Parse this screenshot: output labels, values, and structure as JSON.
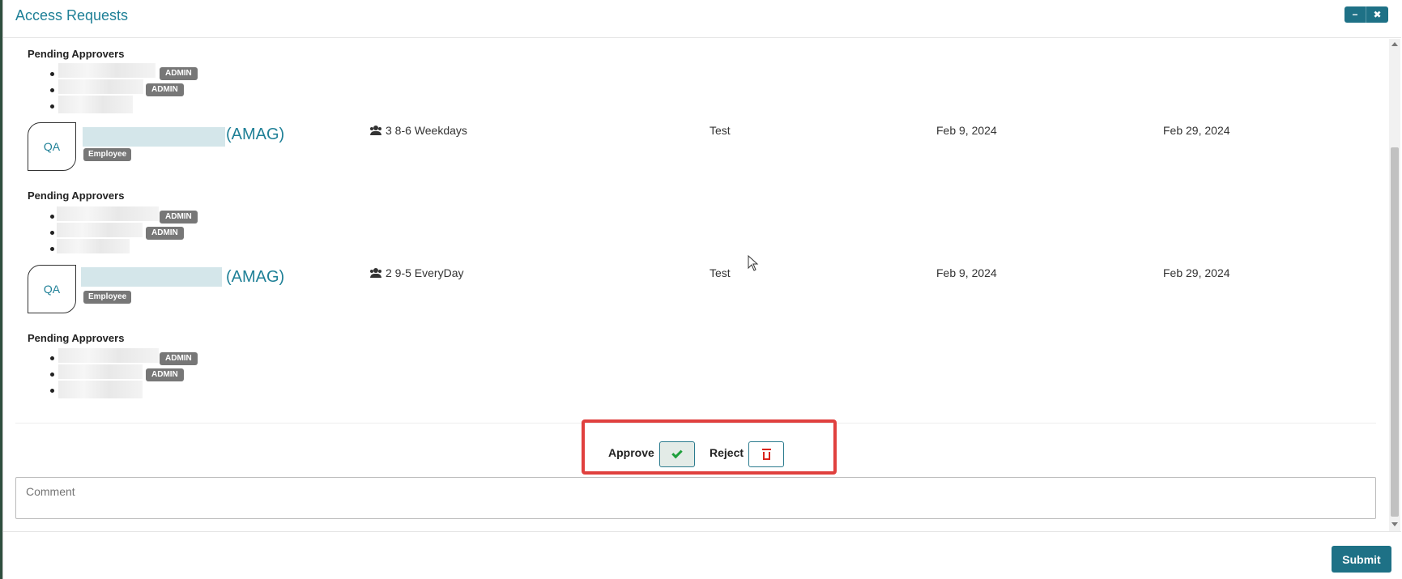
{
  "window": {
    "title": "Access Requests",
    "minimize_glyph": "−",
    "close_glyph": "✖"
  },
  "requests": [
    {
      "pending_label": "Pending Approvers",
      "approvers": [
        {
          "role": "ADMIN"
        },
        {
          "role": "ADMIN"
        },
        {
          "role": ""
        }
      ]
    },
    {
      "avatar_initials": "QA",
      "org_tag": "(AMAG)",
      "person_type": "Employee",
      "schedule": "3 8-6 Weekdays",
      "reason": "Test",
      "start_date": "Feb 9, 2024",
      "end_date": "Feb 29, 2024",
      "pending_label": "Pending Approvers",
      "approvers": [
        {
          "role": "ADMIN"
        },
        {
          "role": "ADMIN"
        },
        {
          "role": ""
        }
      ]
    },
    {
      "avatar_initials": "QA",
      "org_tag": "(AMAG)",
      "person_type": "Employee",
      "schedule": "2 9-5 EveryDay",
      "reason": "Test",
      "start_date": "Feb 9, 2024",
      "end_date": "Feb 29, 2024",
      "pending_label": "Pending Approvers",
      "approvers": [
        {
          "role": "ADMIN"
        },
        {
          "role": "ADMIN"
        },
        {
          "role": ""
        }
      ]
    }
  ],
  "actions": {
    "approve_label": "Approve",
    "reject_label": "Reject"
  },
  "comment": {
    "placeholder": "Comment",
    "value": ""
  },
  "footer": {
    "submit_label": "Submit"
  },
  "icons": {
    "schedule": "users-icon",
    "approve": "check-icon",
    "reject": "trash-icon"
  },
  "colors": {
    "accent": "#1f8097",
    "button": "#1e7186",
    "badge": "#777777",
    "highlight": "#e0403e",
    "approve_icon": "#1fa03d",
    "reject_icon": "#d9251d"
  }
}
